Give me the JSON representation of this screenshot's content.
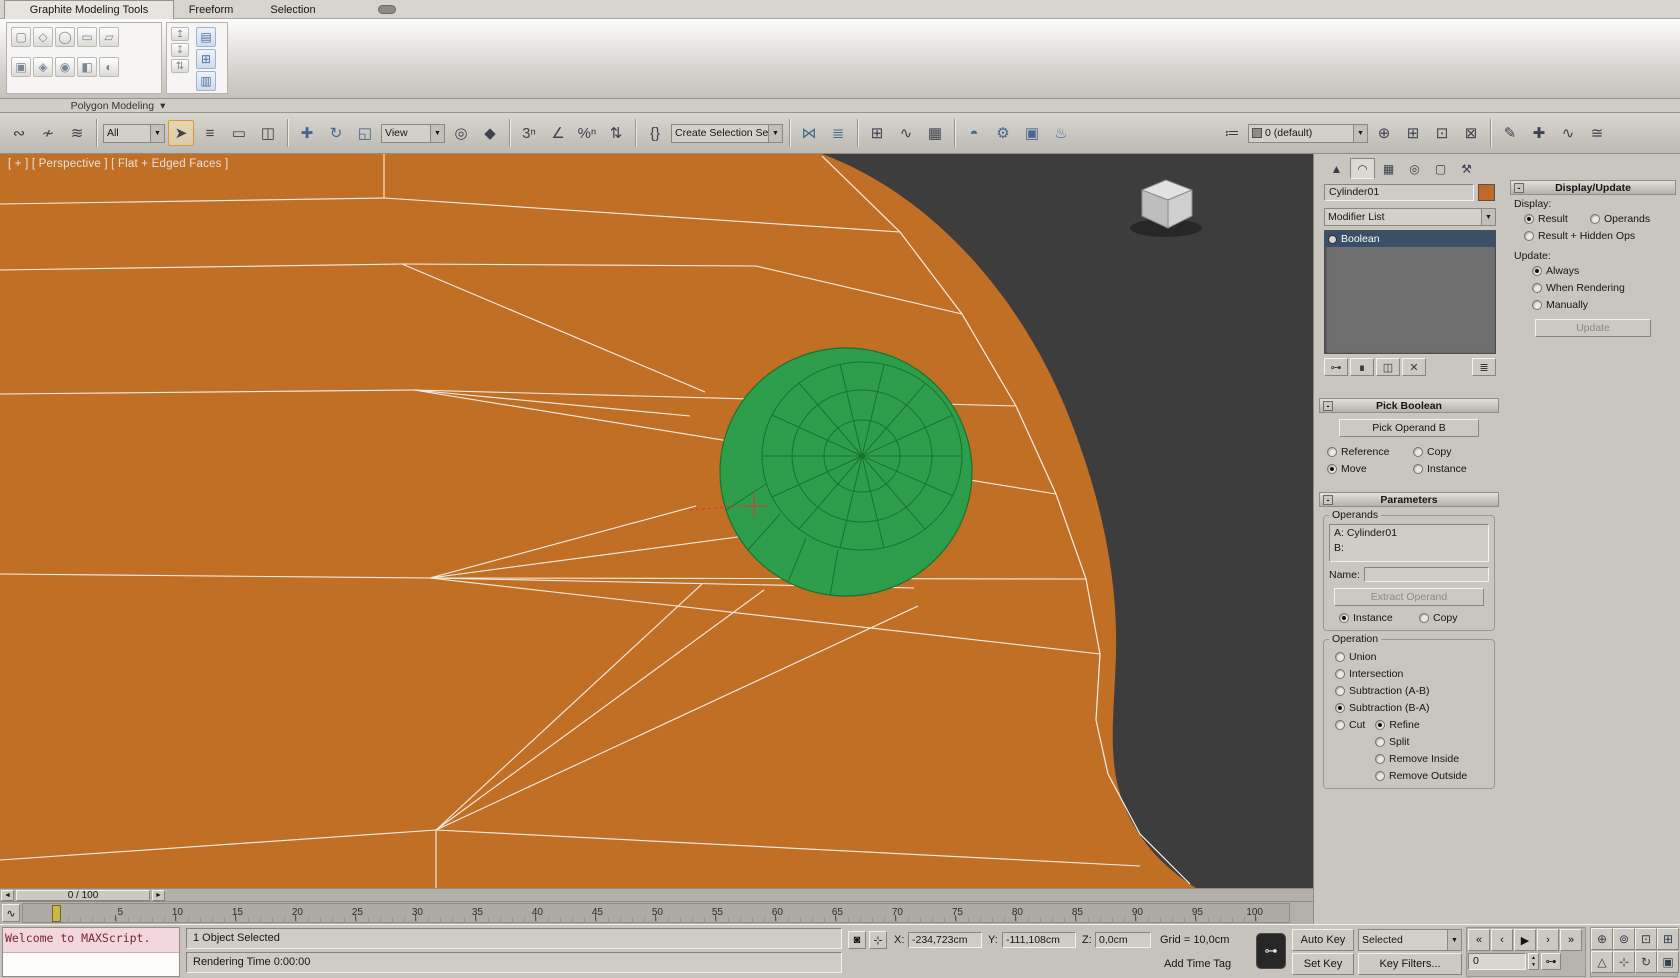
{
  "colors": {
    "vp-bg": "#3d3d3d",
    "mesh": "#c26f26",
    "mesh-edge": "#f3efe8",
    "cyl-green": "#2f9e4c",
    "cyl-edge": "#15742f",
    "accent-orange": "#c06a28"
  },
  "ribbon": {
    "tab1": "Graphite Modeling Tools",
    "tab2": "Freeform",
    "tab3": "Selection",
    "panel_caption": "Polygon Modeling",
    "icons_row1": [
      "▢",
      "◇",
      "◯",
      "▭",
      "▱"
    ],
    "icons_row2": [
      "▣",
      "◈",
      "◉",
      "◧",
      "◐"
    ],
    "side_col1": [
      "↥",
      "↧",
      "⇅"
    ],
    "side_col2": [
      "▤",
      "⊞",
      "▥"
    ]
  },
  "icons": {
    "caret_down": "▾",
    "dropdown_arrow": "▼",
    "slider_left": "◄",
    "slider_right": "►",
    "minus": "-",
    "spin_up": "▲",
    "spin_down": "▼",
    "link": "∾",
    "unlink": "≁",
    "spacewarp": "≋",
    "select_object": "➤",
    "select_by_name": "≡",
    "rect_region": "▭",
    "window_crossing": "◫",
    "move": "✚",
    "rotate": "↻",
    "scale": "◱",
    "pivot_center": "◎",
    "manipulate": "◆",
    "snap3": "3ⁿ",
    "angle_snap": "∠",
    "percent_snap": "%ⁿ",
    "spinner_snap": "⇅",
    "named_sets": "{}",
    "mirror": "⋈",
    "align": "≣",
    "layer_explorer": "⊞",
    "curve_editor": "∿",
    "schematic": "▦",
    "material_editor": "◓",
    "render_setup": "⚙",
    "rendered_frame": "▣",
    "render_production": "♨",
    "layer_list": "≔",
    "new_layer": "⊕",
    "add_to_layer": "⊞",
    "select_in_layer": "⊡",
    "set_current_layer": "⊠",
    "misc1": "✎",
    "misc2": "✚",
    "misc3": "∿",
    "misc4": "≅",
    "mini_curve": "∿",
    "lock": "◙",
    "abs_mode": "⊹",
    "key": "⊶"
  },
  "toolbar": {
    "selection_filter_value": "All",
    "ref_coord_value": "View",
    "named_sel_value": "Create Selection Se",
    "layer_value": "0 (default)"
  },
  "viewport": {
    "label": "[ + ] [ Perspective ] [ Flat + Edged Faces ]"
  },
  "command_panel": {
    "tabs": [
      {
        "glyph": "▲",
        "name": "tab-create",
        "sel": "0"
      },
      {
        "glyph": "◠",
        "name": "tab-modify",
        "sel": "1"
      },
      {
        "glyph": "▦",
        "name": "tab-hierarchy",
        "sel": "0"
      },
      {
        "glyph": "◎",
        "name": "tab-motion",
        "sel": "0"
      },
      {
        "glyph": "▢",
        "name": "tab-display",
        "sel": "0"
      },
      {
        "glyph": "⚒",
        "name": "tab-utilities",
        "sel": "0"
      }
    ],
    "object_name": "Cylinder01",
    "modifier_list_label": "Modifier List",
    "stack_selected": "Boolean",
    "stack_buttons": [
      {
        "glyph": "⊶",
        "name": "pin-stack-button"
      },
      {
        "glyph": "∎",
        "name": "show-end-result-button"
      },
      {
        "glyph": "◫",
        "name": "make-unique-button"
      },
      {
        "glyph": "✕",
        "name": "remove-modifier-button"
      }
    ],
    "config_button_glyph": "≣",
    "pick_boolean": {
      "title": "Pick Boolean",
      "pick_button": "Pick Operand B",
      "clone_options": [
        {
          "label": "Reference",
          "sel": "0"
        },
        {
          "label": "Copy",
          "sel": "0"
        },
        {
          "label": "Move",
          "sel": "1"
        },
        {
          "label": "Instance",
          "sel": "0"
        }
      ]
    },
    "parameters": {
      "title": "Parameters",
      "operands_group": "Operands",
      "operand_a": "A: Cylinder01",
      "operand_b": "B:",
      "name_label": "Name:",
      "extract_button": "Extract Operand",
      "extract_options": [
        {
          "label": "Instance",
          "sel": "1"
        },
        {
          "label": "Copy",
          "sel": "0"
        }
      ],
      "operation_group": "Operation",
      "operations": [
        {
          "label": "Union",
          "sel": "0"
        },
        {
          "label": "Intersection",
          "sel": "0"
        },
        {
          "label": "Subtraction (A-B)",
          "sel": "0"
        },
        {
          "label": "Subtraction (B-A)",
          "sel": "1"
        }
      ],
      "cut_label": "Cut",
      "cut_sel": "0",
      "refine_label": "Refine",
      "refine_sel": "1",
      "cut_rest": [
        {
          "label": "Split",
          "sel": "0"
        },
        {
          "label": "Remove Inside",
          "sel": "0"
        },
        {
          "label": "Remove Outside",
          "sel": "0"
        }
      ]
    },
    "display_update": {
      "title": "Display/Update",
      "display_label": "Display:",
      "display_row": [
        {
          "label": "Result",
          "sel": "1"
        },
        {
          "label": "Operands",
          "sel": "0"
        }
      ],
      "hidden_label": "Result + Hidden Ops",
      "hidden_sel": "0",
      "update_label": "Update:",
      "update_options": [
        {
          "label": "Always",
          "sel": "1"
        },
        {
          "label": "When Rendering",
          "sel": "0"
        },
        {
          "label": "Manually",
          "sel": "0"
        }
      ],
      "update_button": "Update"
    }
  },
  "timeline": {
    "slider_label": "0 / 100",
    "ticks": [
      "5",
      "10",
      "15",
      "20",
      "25",
      "30",
      "35",
      "40",
      "45",
      "50",
      "55",
      "60",
      "65",
      "70",
      "75",
      "80",
      "85",
      "90",
      "95",
      "100"
    ]
  },
  "status_bar": {
    "maxscript_line": "Welcome to MAXScript.",
    "status_line": "1 Object Selected",
    "progress_line": "Rendering Time  0:00:00",
    "x_label": "X:",
    "x_value": "-234,723cm",
    "y_label": "Y:",
    "y_value": "-111,108cm",
    "z_label": "Z:",
    "z_value": "0,0cm",
    "grid_label": "Grid = 10,0cm",
    "time_tag_label": "Add Time Tag",
    "auto_key": "Auto Key",
    "set_key": "Set Key",
    "key_mode_value": "Selected",
    "key_filters": "Key Filters...",
    "frame_value": "0",
    "playback": [
      {
        "glyph": "«",
        "name": "go-to-start-button"
      },
      {
        "glyph": "‹",
        "name": "previous-frame-button"
      },
      {
        "glyph": "▶",
        "name": "play-button"
      },
      {
        "glyph": "›",
        "name": "next-frame-button"
      },
      {
        "glyph": "»",
        "name": "go-to-end-button"
      }
    ],
    "nav": [
      {
        "glyph": "⊕",
        "name": "zoom-icon"
      },
      {
        "glyph": "⊚",
        "name": "zoom-all-icon"
      },
      {
        "glyph": "⊡",
        "name": "zoom-extents-icon"
      },
      {
        "glyph": "⊞",
        "name": "zoom-extents-all-icon"
      },
      {
        "glyph": "△",
        "name": "fov-icon"
      },
      {
        "glyph": "⊹",
        "name": "pan-icon"
      },
      {
        "glyph": "↻",
        "name": "orbit-icon"
      },
      {
        "glyph": "▣",
        "name": "maximize-viewport-icon"
      }
    ]
  }
}
